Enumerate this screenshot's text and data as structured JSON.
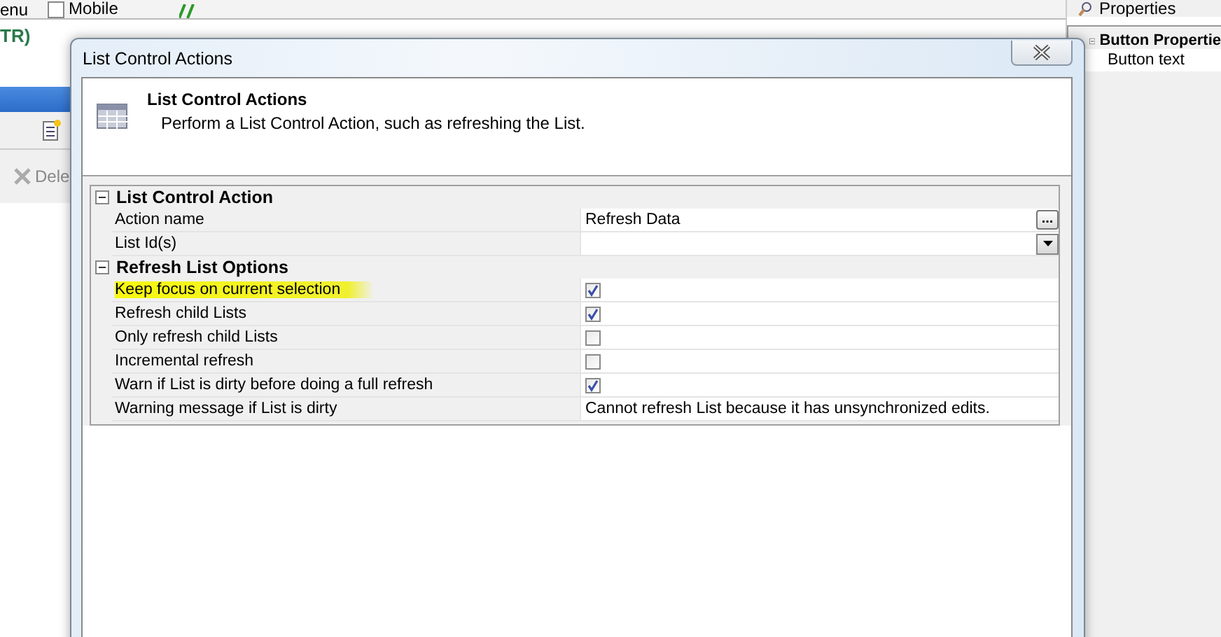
{
  "background": {
    "menu_label": "enu",
    "mobile_checkbox": {
      "label": "Mobile",
      "checked": false
    },
    "heading": "TR)",
    "delete_label": "Dele",
    "properties_title": "Properties",
    "properties_group": "Button Propertie",
    "properties_row": "Button text"
  },
  "dialog": {
    "title": "List Control Actions",
    "header_title": "List Control Actions",
    "header_description": "Perform a List Control Action, such as refreshing the List.",
    "groups": [
      {
        "label": "List Control Action",
        "expanded": true,
        "rows": [
          {
            "kind": "text",
            "label": "Action name",
            "value": "Refresh Data",
            "button": "...",
            "highlighted": false
          },
          {
            "kind": "dropdown",
            "label": "List Id(s)",
            "highlighted": false
          }
        ]
      },
      {
        "label": "Refresh List Options",
        "expanded": true,
        "rows": [
          {
            "kind": "checkbox",
            "label": "Keep focus on current selection",
            "checked": true,
            "highlighted": true
          },
          {
            "kind": "checkbox",
            "label": "Refresh child Lists",
            "checked": true,
            "highlighted": false
          },
          {
            "kind": "checkbox",
            "label": "Only refresh child Lists",
            "checked": false,
            "highlighted": false
          },
          {
            "kind": "checkbox",
            "label": "Incremental refresh",
            "checked": false,
            "highlighted": false
          },
          {
            "kind": "checkbox",
            "label": "Warn if List is dirty before doing a full refresh",
            "checked": true,
            "highlighted": false
          },
          {
            "kind": "text",
            "label": "Warning message if List is dirty",
            "value": "Cannot refresh List because it has unsynchronized edits.",
            "highlighted": false
          }
        ]
      }
    ]
  }
}
